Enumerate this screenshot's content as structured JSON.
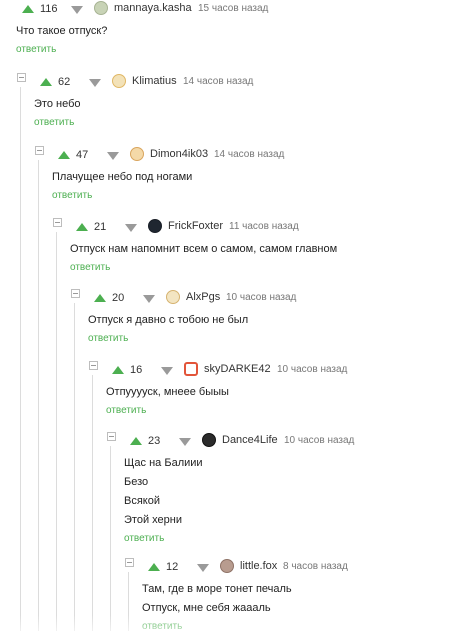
{
  "reply_label": "ответить",
  "comments": [
    {
      "rating": "116",
      "nick": "mannaya.kasha",
      "time": "15 часов назад",
      "avatar_icon": "avatar-kasha",
      "lines": [
        "Что такое отпуск?"
      ]
    },
    {
      "rating": "62",
      "nick": "Klimatius",
      "time": "14 часов назад",
      "avatar_icon": "avatar-klimatius",
      "lines": [
        "Это небо"
      ]
    },
    {
      "rating": "47",
      "nick": "Dimon4ik03",
      "time": "14 часов назад",
      "avatar_icon": "avatar-dimon",
      "lines": [
        "Плачущее небо под ногами"
      ]
    },
    {
      "rating": "21",
      "nick": "FrickFoxter",
      "time": "11 часов назад",
      "avatar_icon": "avatar-frick",
      "lines": [
        "Отпуск нам напомнит всем о самом, самом главном"
      ]
    },
    {
      "rating": "20",
      "nick": "AlxPgs",
      "time": "10 часов назад",
      "avatar_icon": "avatar-alxpgs",
      "lines": [
        "Отпуск я давно с тобою не был"
      ]
    },
    {
      "rating": "16",
      "nick": "skyDARKE42",
      "time": "10 часов назад",
      "avatar_icon": "avatar-skydarke",
      "lines": [
        "Отпууууск, мнеее быыы"
      ]
    },
    {
      "rating": "23",
      "nick": "Dance4Life",
      "time": "10 часов назад",
      "avatar_icon": "avatar-dance",
      "lines": [
        "Щас на Балиии",
        "Безо",
        "Всякой",
        "Этой херни"
      ]
    },
    {
      "rating": "12",
      "nick": "little.fox",
      "time": "8 часов назад",
      "avatar_icon": "avatar-littlefox",
      "lines": [
        "Там, где в море тонет печаль",
        "Отпуск, мне себя жаааль"
      ]
    }
  ],
  "colors": {
    "upvote": "#4caf50",
    "downvote": "#9a9a9a",
    "reply_link": "#4caf50",
    "thread_line": "#dcdcdc"
  }
}
